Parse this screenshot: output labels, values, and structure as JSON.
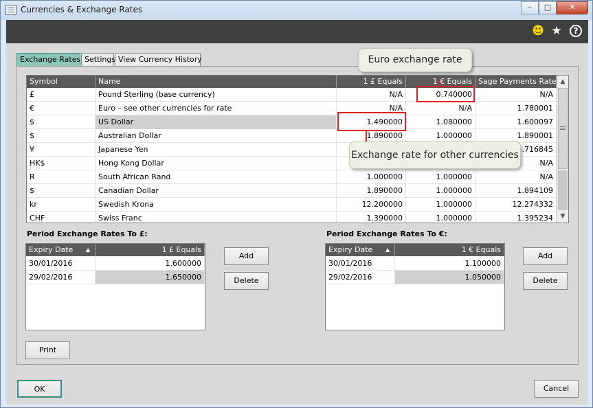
{
  "window": {
    "title": "Currencies & Exchange Rates",
    "min": "–",
    "max": "□",
    "close": "✕"
  },
  "header": {
    "smile_glyph": "☻",
    "star_glyph": "★",
    "help_glyph": "?"
  },
  "tabs": [
    {
      "label": "Exchange Rates",
      "active": true
    },
    {
      "label": "Settings",
      "active": false
    },
    {
      "label": "View Currency History",
      "active": false
    }
  ],
  "grid": {
    "headers": [
      "Symbol",
      "Name",
      "1 £ Equals",
      "1 € Equals",
      "Sage Payments Rate"
    ],
    "rows": [
      [
        "£",
        "Pound Sterling (base currency)",
        "N/A",
        "0.740000",
        "N/A"
      ],
      [
        "€",
        "Euro – see other currencies for rate",
        "N/A",
        "N/A",
        "1.780001"
      ],
      [
        "$",
        "US Dollar",
        "1.490000",
        "1.080000",
        "1.600097"
      ],
      [
        "$",
        "Australian Dollar",
        "1.890000",
        "1.000000",
        "1.890001"
      ],
      [
        "¥",
        "Japanese Yen",
        "",
        "",
        "74.716845"
      ],
      [
        "HK$",
        "Hong Kong Dollar",
        "",
        "",
        "N/A"
      ],
      [
        "R",
        "South African Rand",
        "1.000000",
        "1.000000",
        "N/A"
      ],
      [
        "$",
        "Canadian Dollar",
        "1.890000",
        "1.000000",
        "1.894109"
      ],
      [
        "kr",
        "Swedish Krona",
        "12.200000",
        "1.000000",
        "12.274332"
      ],
      [
        "CHF",
        "Swiss Franc",
        "1.390000",
        "1.000000",
        "1.395234"
      ]
    ],
    "selected_row": 2
  },
  "callouts": {
    "euro": "Euro exchange rate",
    "other": "Exchange rate for other currencies"
  },
  "period_gbp": {
    "label": "Period Exchange Rates To £:",
    "headers": [
      "Expiry Date",
      "1 £ Equals"
    ],
    "rows": [
      [
        "30/01/2016",
        "1.600000"
      ],
      [
        "29/02/2016",
        "1.650000"
      ]
    ],
    "add": "Add",
    "delete": "Delete"
  },
  "period_eur": {
    "label": "Period Exchange Rates To €:",
    "headers": [
      "Expiry Date",
      "1 € Equals"
    ],
    "rows": [
      [
        "30/01/2016",
        "1.100000"
      ],
      [
        "29/02/2016",
        "1.050000"
      ]
    ],
    "add": "Add",
    "delete": "Delete"
  },
  "buttons": {
    "print": "Print",
    "ok": "OK",
    "cancel": "Cancel"
  },
  "colors": {
    "active_tab": "#8dc7b9",
    "highlight": "#e02020",
    "header_bg": "#5a5a5a"
  }
}
